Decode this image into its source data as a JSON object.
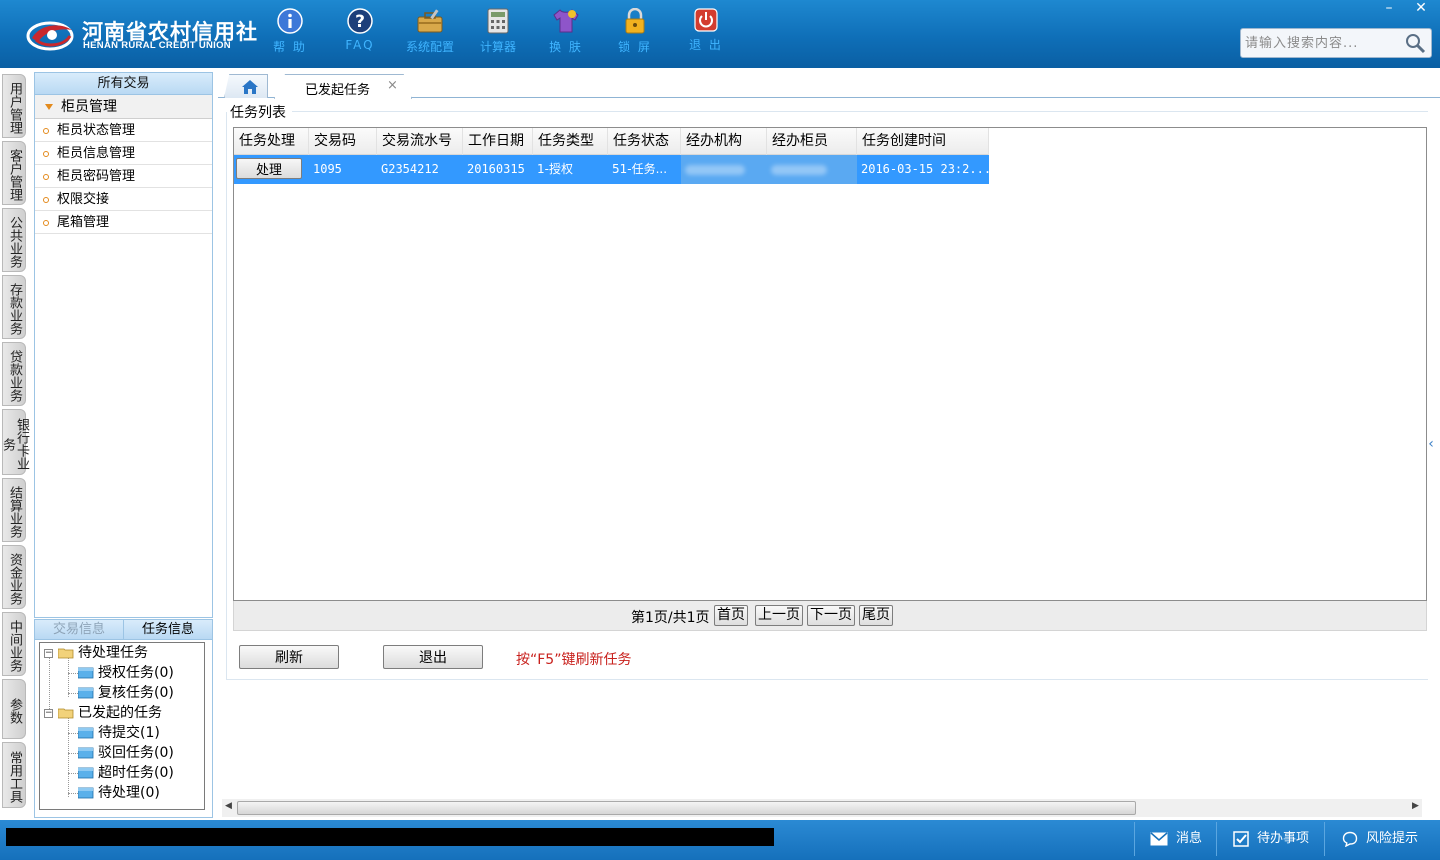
{
  "brand": {
    "name_cn": "河南省农村信用社",
    "name_en": "HENAN RURAL CREDIT UNION",
    "accent": "#0f6fb8",
    "logo_red": "#c9282d"
  },
  "toolbar": [
    {
      "label": "帮 助",
      "icon": "info-icon"
    },
    {
      "label": "FAQ",
      "icon": "question-icon"
    },
    {
      "label": "系统配置",
      "icon": "toolbox-icon"
    },
    {
      "label": "计算器",
      "icon": "calculator-icon"
    },
    {
      "label": "换 肤",
      "icon": "tshirt-icon"
    },
    {
      "label": "锁 屏",
      "icon": "lock-icon"
    },
    {
      "label": "退 出",
      "icon": "power-icon"
    }
  ],
  "window": {
    "minimize": "–",
    "close": "✕"
  },
  "search": {
    "placeholder": "请输入搜索内容...",
    "value": ""
  },
  "vertical_tabs": [
    "用户管理",
    "客户管理",
    "公共业务",
    "存款业务",
    "贷款业务",
    "银行卡业务",
    "结算业务",
    "资金业务",
    "中间业务",
    "参数",
    "常用工具"
  ],
  "nav": {
    "header": "所有交易",
    "group": "柜员管理",
    "items": [
      "柜员状态管理",
      "柜员信息管理",
      "柜员密码管理",
      "权限交接",
      "尾箱管理"
    ]
  },
  "info_panel": {
    "tabs": [
      "交易信息",
      "任务信息"
    ],
    "active_tab": "任务信息",
    "tree": {
      "pending": {
        "label": "待处理任务",
        "children": [
          "授权任务(0)",
          "复核任务(0)"
        ]
      },
      "initiated": {
        "label": "已发起的任务",
        "children": [
          "待提交(1)",
          "驳回任务(0)",
          "超时任务(0)",
          "待处理(0)"
        ]
      }
    }
  },
  "tabs": {
    "active_title": "已发起任务",
    "close": "×"
  },
  "task_list": {
    "legend": "任务列表",
    "columns": [
      "任务处理",
      "交易码",
      "交易流水号",
      "工作日期",
      "任务类型",
      "任务状态",
      "经办机构",
      "经办柜员",
      "任务创建时间"
    ],
    "rows": [
      {
        "action": "处理",
        "code": "1095",
        "serial": "G2354212",
        "date": "20160315",
        "type": "1-授权",
        "status": "51-任务...",
        "org": "",
        "teller": "",
        "created": "2016-03-15 23:2..."
      }
    ],
    "selected_row_color": "#3399ff"
  },
  "pager": {
    "text": "第1页/共1页",
    "first": "首页",
    "prev": "上一页",
    "next": "下一页",
    "last": "尾页"
  },
  "actions": {
    "refresh": "刷新",
    "exit": "退出",
    "hint": "按“F5”键刷新任务"
  },
  "status_bar": {
    "messages": "消息",
    "todo": "待办事项",
    "risk": "风险提示"
  }
}
